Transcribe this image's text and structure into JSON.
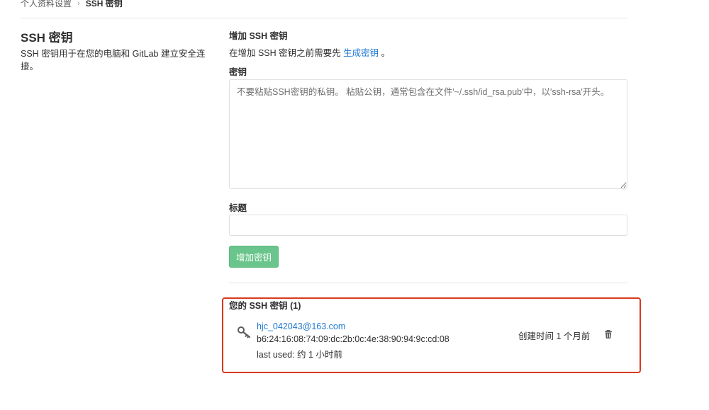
{
  "breadcrumb": {
    "parent": "个人资料设置",
    "separator": "›",
    "current": "SSH 密钥"
  },
  "sidebar_info": {
    "title": "SSH 密钥",
    "description": "SSH 密钥用于在您的电脑和 GitLab 建立安全连接。"
  },
  "form": {
    "heading": "增加 SSH 密钥",
    "hint_prefix": "在增加 SSH 密钥之前需要先",
    "hint_link": "生成密钥",
    "hint_suffix": "。",
    "key_label": "密钥",
    "key_placeholder": "不要粘贴SSH密钥的私钥。 粘贴公钥，通常包含在文件'~/.ssh/id_rsa.pub'中，以'ssh-rsa'开头。",
    "key_value": "",
    "title_label": "标题",
    "title_value": "",
    "submit_label": "增加密钥"
  },
  "keys": {
    "heading": "您的 SSH 密钥 (1)",
    "items": [
      {
        "title": "hjc_042043@163.com",
        "fingerprint": "b6:24:16:08:74:09:dc:2b:0c:4e:38:90:94:9c:cd:08",
        "last_used": "last used: 约 1 小时前",
        "created": "创建时间 1 个月前",
        "icon": "key-icon"
      }
    ]
  },
  "colors": {
    "link": "#1f78d1",
    "button": "#69c58b",
    "highlight_border": "#d9391e"
  }
}
